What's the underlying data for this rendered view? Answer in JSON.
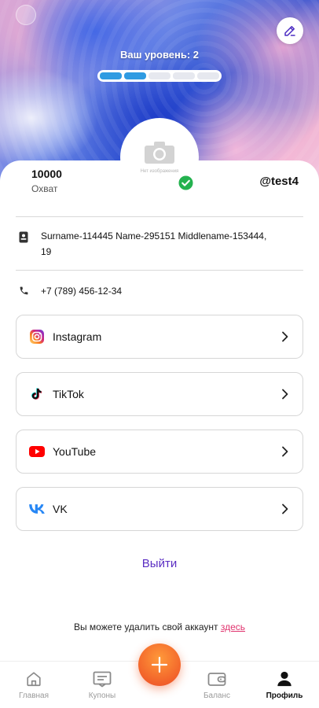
{
  "header": {
    "level_label": "Ваш уровень: 2",
    "level_current": 2,
    "level_total": 5,
    "accent_color": "#2f9be2"
  },
  "profile": {
    "avatar_caption": "Нет изображения",
    "reach_value": "10000",
    "reach_label": "Охват",
    "username": "@test4",
    "verified_icon": "check-circle-icon",
    "full_name": "Surname-114445 Name-295151 Middlename-153444, 19",
    "phone": "+7 (789) 456-12-34"
  },
  "socials": [
    {
      "name": "Instagram",
      "icon": "instagram-icon"
    },
    {
      "name": "TikTok",
      "icon": "tiktok-icon"
    },
    {
      "name": "YouTube",
      "icon": "youtube-icon"
    },
    {
      "name": "VK",
      "icon": "vk-icon"
    }
  ],
  "actions": {
    "logout_label": "Выйти",
    "delete_text": "Вы можете удалить свой аккаунт",
    "delete_link": "здесь"
  },
  "bottom_nav": {
    "items": [
      {
        "label": "Главная",
        "icon": "home-icon"
      },
      {
        "label": "Купоны",
        "icon": "coupon-icon"
      },
      {
        "label": "Баланс",
        "icon": "wallet-icon"
      },
      {
        "label": "Профиль",
        "icon": "user-icon",
        "active": true
      }
    ],
    "fab_icon": "plus-icon"
  }
}
